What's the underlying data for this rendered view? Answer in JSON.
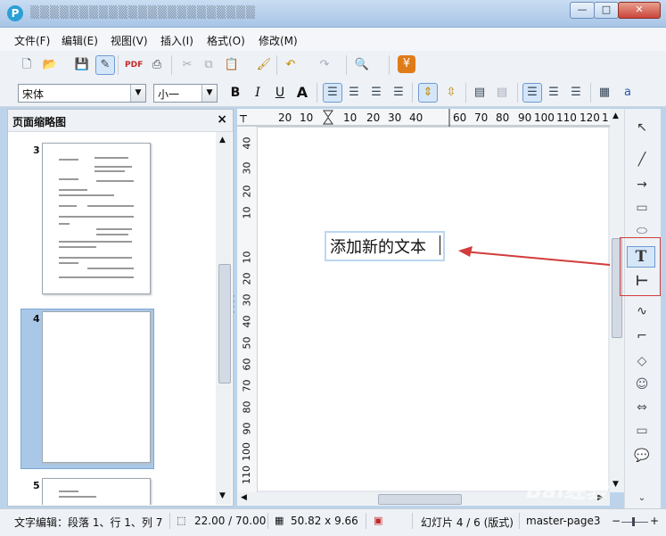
{
  "menu": [
    "文件(F)",
    "编辑(E)",
    "视图(V)",
    "插入(I)",
    "格式(O)",
    "修改(M)"
  ],
  "toolbar2": {
    "font_name": "宋体",
    "font_size": "小一",
    "bold": "B",
    "italic": "I",
    "underline": "U",
    "shadow": "A"
  },
  "panel": {
    "title": "页面缩略图",
    "close": "×",
    "slides": [
      {
        "num": "3"
      },
      {
        "num": "4"
      },
      {
        "num": "5"
      }
    ]
  },
  "ruler": {
    "h_labels": [
      "20",
      "10",
      "10",
      "20",
      "30",
      "40",
      "60",
      "70",
      "80",
      "90",
      "100",
      "110",
      "120",
      "1"
    ],
    "v_labels": [
      "40",
      "30",
      "20",
      "10",
      "10",
      "20",
      "30",
      "40",
      "50",
      "60",
      "70",
      "80",
      "90",
      "100",
      "110"
    ]
  },
  "canvas": {
    "textbox_text": "添加新的文本"
  },
  "statusbar": {
    "edit_mode": "文字编辑：段落 1、行 1、列 7",
    "position": "22.00 / 70.00",
    "size": "50.82 x 9.66",
    "slide": "幻灯片 4 / 6 (版式)",
    "master": "master-page3"
  },
  "watermark": "Bai经验",
  "colors": {
    "annotation_red": "#d23c3c",
    "selection_blue": "#a9c8e8",
    "title_blue": "#a8c5e6"
  }
}
